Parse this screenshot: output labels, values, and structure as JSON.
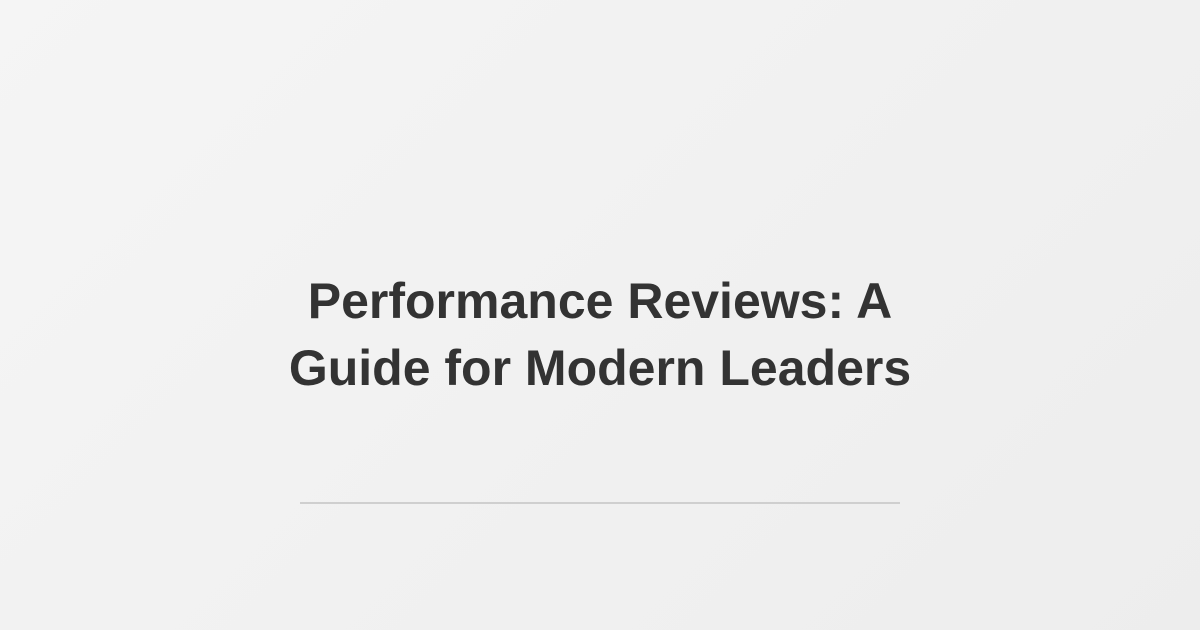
{
  "title": {
    "line1": "Performance Reviews: A",
    "line2": "Guide for Modern Leaders"
  },
  "colors": {
    "background": "#f2f2f2",
    "title_text": "#333333",
    "divider": "#cfcfcf"
  }
}
